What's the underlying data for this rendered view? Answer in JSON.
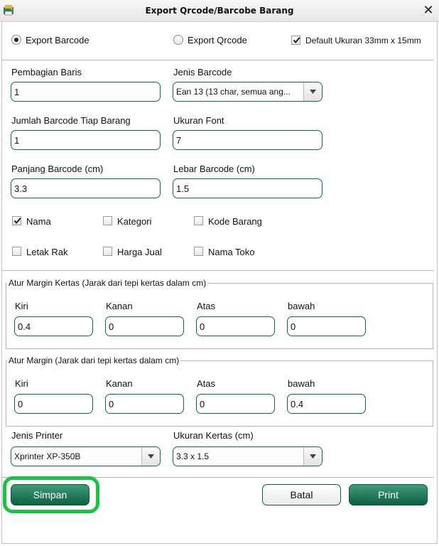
{
  "window": {
    "title": "Export Qrcode/Barcobe Barang",
    "close_glyph": "✕"
  },
  "export_type": {
    "barcode_label": "Export Barcode",
    "barcode_selected": true,
    "qrcode_label": "Export Qrcode",
    "qrcode_selected": false,
    "default_size_label": "Default Ukuran 33mm x 15mm",
    "default_size_checked": true
  },
  "fields": {
    "pembagian_baris": {
      "label": "Pembagian Baris",
      "value": "1"
    },
    "jenis_barcode": {
      "label": "Jenis Barcode",
      "value": "Ean 13 (13 char, semua ang..."
    },
    "jumlah_barcode": {
      "label": "Jumlah Barcode Tiap Barang",
      "value": "1"
    },
    "ukuran_font": {
      "label": "Ukuran Font",
      "value": "7"
    },
    "panjang_barcode": {
      "label": "Panjang Barcode (cm)",
      "value": "3.3"
    },
    "lebar_barcode": {
      "label": "Lebar Barcode (cm)",
      "value": "1.5"
    }
  },
  "options": {
    "nama": {
      "label": "Nama",
      "checked": true
    },
    "kategori": {
      "label": "Kategori",
      "checked": false
    },
    "kode_barang": {
      "label": "Kode Barang",
      "checked": false
    },
    "letak_rak": {
      "label": "Letak Rak",
      "checked": false
    },
    "harga_jual": {
      "label": "Harga Jual",
      "checked": false
    },
    "nama_toko": {
      "label": "Nama Toko",
      "checked": false
    }
  },
  "margin_kertas": {
    "title": "Atur Margin Kertas (Jarak dari tepi kertas dalam cm)",
    "kiri": {
      "label": "Kiri",
      "value": "0.4"
    },
    "kanan": {
      "label": "Kanan",
      "value": "0"
    },
    "atas": {
      "label": "Atas",
      "value": "0"
    },
    "bawah": {
      "label": "bawah",
      "value": "0"
    }
  },
  "margin": {
    "title": "Atur Margin (Jarak dari tepi kertas dalam cm)",
    "kiri": {
      "label": "Kiri",
      "value": "0"
    },
    "kanan": {
      "label": "Kanan",
      "value": "0"
    },
    "atas": {
      "label": "Atas",
      "value": "0"
    },
    "bawah": {
      "label": "bawah",
      "value": "0.4"
    }
  },
  "printer": {
    "jenis_printer": {
      "label": "Jenis Printer",
      "value": "Xprinter XP-350B"
    },
    "ukuran_kertas": {
      "label": "Ukuran Kertas (cm)",
      "value": "3.3 x 1.5"
    }
  },
  "buttons": {
    "simpan": "Simpan",
    "batal": "Batal",
    "print": "Print"
  },
  "colors": {
    "accent": "#0f5f43",
    "highlight": "#19c443"
  }
}
